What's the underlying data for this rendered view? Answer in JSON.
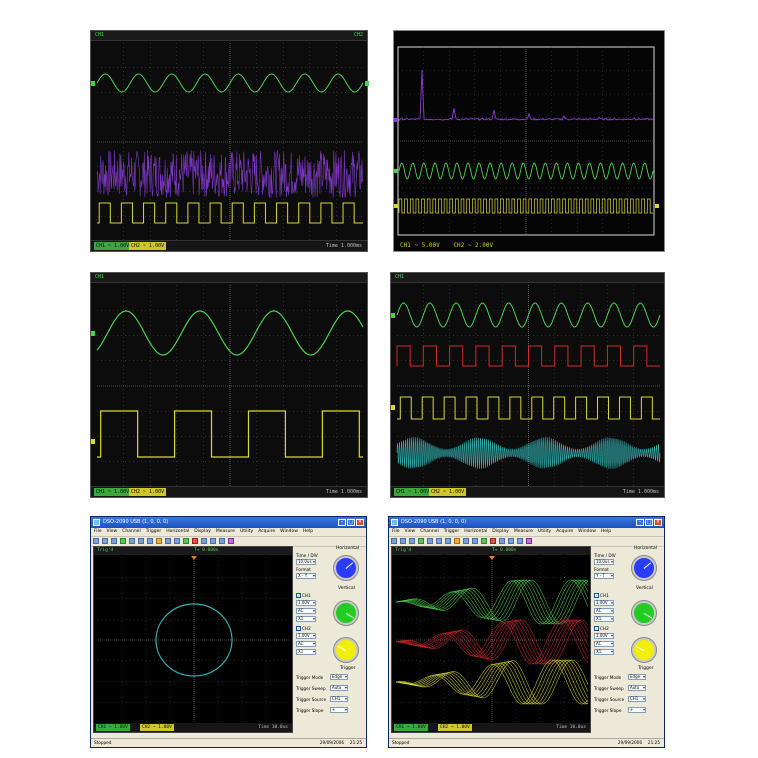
{
  "panels": {
    "p1": {
      "header_left": "CH1",
      "header_right": "CH2",
      "status": {
        "ch1": "CH1 ~ 1.00V",
        "ch2": "CH2 ~ 1.00V",
        "time": "Time 1.000ms"
      }
    },
    "p2": {
      "readout": {
        "ch1": "CH1 ~ 5.00V",
        "ch2": "CH2 ~ 2.00V"
      }
    },
    "p3": {
      "header_left": "CH1",
      "status": {
        "ch1": "CH1 ~ 1.00V",
        "ch2": "CH2 ~ 1.00V",
        "time": "Time 1.000ms"
      }
    },
    "p4": {
      "header_left": "CH1",
      "status": {
        "ch1": "CH1 ~ 1.00V",
        "ch2": "CH2 ~ 1.00V",
        "time": "Time 1.000ms"
      }
    }
  },
  "software": {
    "title": "DSO-2090 USB (1, 0, 0, 0)",
    "menus": [
      "File",
      "View",
      "Channel",
      "Trigger",
      "Horizontal",
      "Display",
      "Measure",
      "Utility",
      "Acquire",
      "Window",
      "Help"
    ],
    "plot_header": {
      "left": "Trig'd",
      "right": "T+ 0.000s"
    },
    "plot_status": {
      "ch1": "CH1 ~ 1.00V",
      "ch2": "CH2 ~ 1.00V",
      "time": "Time 10.0us"
    },
    "side": {
      "horizontal_title": "Horizontal",
      "time_div_label": "Time / DIV",
      "time_div_value": "10.0us",
      "format_label": "Format",
      "format_value_xy": "X - Y",
      "format_value_yt": "Y - T",
      "vertical_title": "Vertical",
      "ch1_label": "CH1",
      "ch2_label": "CH2",
      "volt": "1.00V",
      "coupling": "AC",
      "probe": "X1",
      "trigger_title": "Trigger",
      "trigger_mode_label": "Trigger Mode",
      "trigger_mode": "Edge",
      "trigger_sweep_label": "Trigger Sweep",
      "trigger_sweep": "Auto",
      "trigger_source_label": "Trigger Source",
      "trigger_source": "CH1",
      "trigger_slope_label": "Trigger Slope",
      "trigger_slope": "+"
    },
    "status_left": "Stopped",
    "status_date": "29/09/2006",
    "status_time": "21:25"
  },
  "colors": {
    "green": "#4ed04e",
    "yellow": "#d8d830",
    "purple": "#8a3cd8",
    "red": "#d02a2a",
    "cyan": "#33b0b0",
    "grid": "#505050",
    "knob_blue": "#2a3cff",
    "knob_green": "#22cc22",
    "knob_yellow": "#f0f000"
  }
}
